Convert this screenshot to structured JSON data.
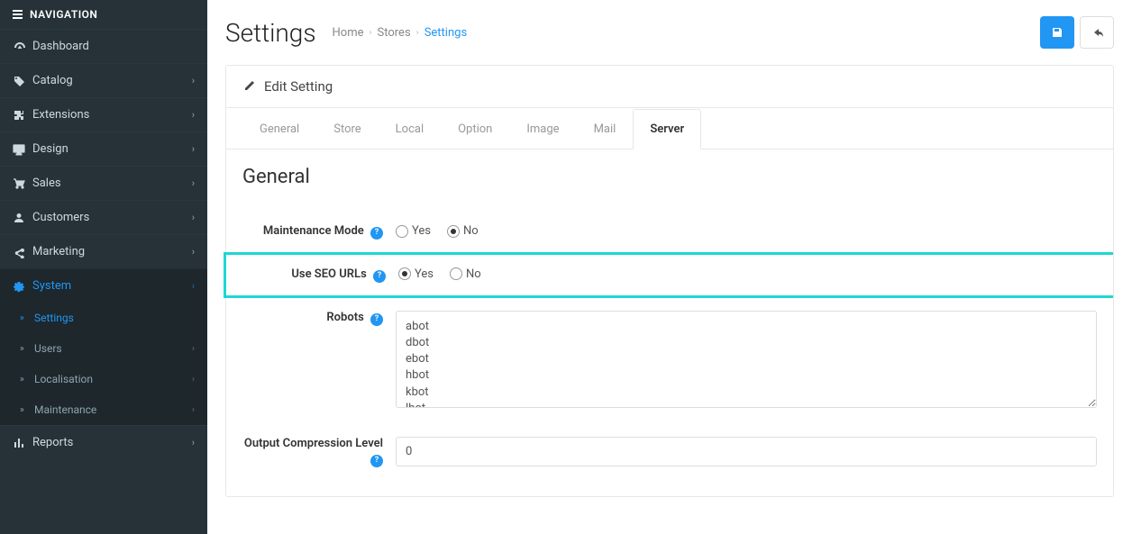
{
  "nav": {
    "header": "NAVIGATION",
    "items": [
      {
        "icon": "tachometer",
        "label": "Dashboard",
        "hasSub": false
      },
      {
        "icon": "tags",
        "label": "Catalog",
        "hasSub": true
      },
      {
        "icon": "puzzle",
        "label": "Extensions",
        "hasSub": true
      },
      {
        "icon": "desktop",
        "label": "Design",
        "hasSub": true
      },
      {
        "icon": "cart",
        "label": "Sales",
        "hasSub": true
      },
      {
        "icon": "user",
        "label": "Customers",
        "hasSub": true
      },
      {
        "icon": "share",
        "label": "Marketing",
        "hasSub": true
      },
      {
        "icon": "cog",
        "label": "System",
        "hasSub": true,
        "active": true
      },
      {
        "icon": "barchart",
        "label": "Reports",
        "hasSub": true
      }
    ],
    "systemSub": [
      {
        "label": "Settings",
        "hasSub": false,
        "active": true
      },
      {
        "label": "Users",
        "hasSub": true
      },
      {
        "label": "Localisation",
        "hasSub": true
      },
      {
        "label": "Maintenance",
        "hasSub": true
      }
    ]
  },
  "page": {
    "title": "Settings",
    "crumbs": {
      "home": "Home",
      "stores": "Stores",
      "settings": "Settings"
    },
    "panelTitle": "Edit Setting"
  },
  "tabs": {
    "general": "General",
    "store": "Store",
    "local": "Local",
    "option": "Option",
    "image": "Image",
    "mail": "Mail",
    "server": "Server"
  },
  "form": {
    "sectionHeading": "General",
    "maintenanceMode": {
      "label": "Maintenance Mode",
      "yes": "Yes",
      "no": "No",
      "value": "no"
    },
    "seoUrls": {
      "label": "Use SEO URLs",
      "yes": "Yes",
      "no": "No",
      "value": "yes"
    },
    "robots": {
      "label": "Robots",
      "value": "abot\ndbot\nebot\nhbot\nkbot\nlbot"
    },
    "outputCompression": {
      "label": "Output Compression Level",
      "value": "0"
    }
  }
}
